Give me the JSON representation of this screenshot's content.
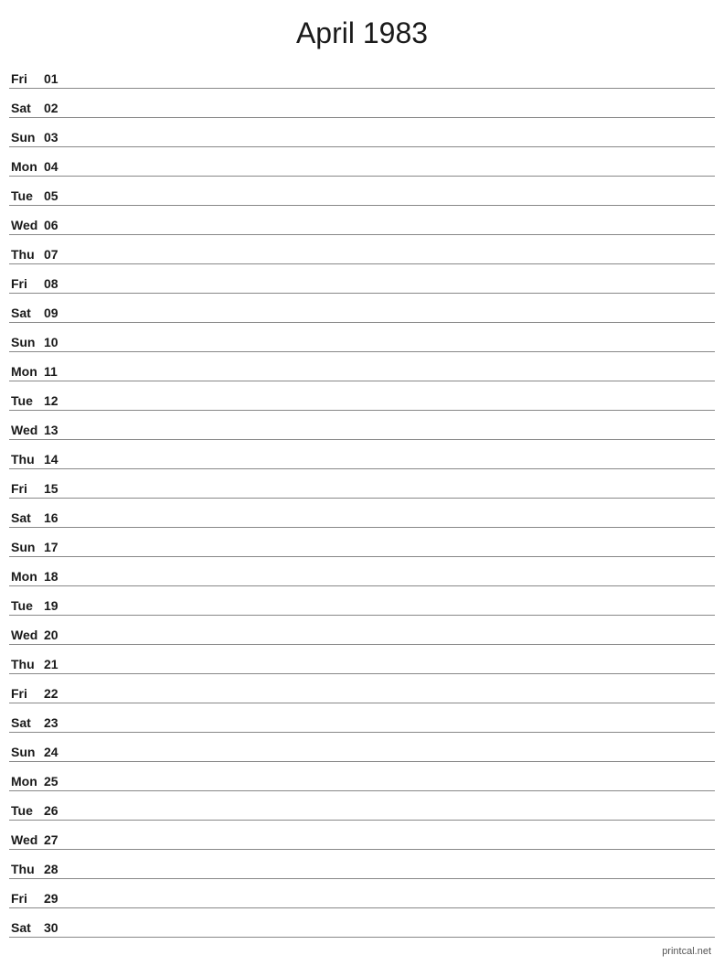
{
  "title": "April 1983",
  "footer": "printcal.net",
  "days": [
    {
      "name": "Fri",
      "number": "01"
    },
    {
      "name": "Sat",
      "number": "02"
    },
    {
      "name": "Sun",
      "number": "03"
    },
    {
      "name": "Mon",
      "number": "04"
    },
    {
      "name": "Tue",
      "number": "05"
    },
    {
      "name": "Wed",
      "number": "06"
    },
    {
      "name": "Thu",
      "number": "07"
    },
    {
      "name": "Fri",
      "number": "08"
    },
    {
      "name": "Sat",
      "number": "09"
    },
    {
      "name": "Sun",
      "number": "10"
    },
    {
      "name": "Mon",
      "number": "11"
    },
    {
      "name": "Tue",
      "number": "12"
    },
    {
      "name": "Wed",
      "number": "13"
    },
    {
      "name": "Thu",
      "number": "14"
    },
    {
      "name": "Fri",
      "number": "15"
    },
    {
      "name": "Sat",
      "number": "16"
    },
    {
      "name": "Sun",
      "number": "17"
    },
    {
      "name": "Mon",
      "number": "18"
    },
    {
      "name": "Tue",
      "number": "19"
    },
    {
      "name": "Wed",
      "number": "20"
    },
    {
      "name": "Thu",
      "number": "21"
    },
    {
      "name": "Fri",
      "number": "22"
    },
    {
      "name": "Sat",
      "number": "23"
    },
    {
      "name": "Sun",
      "number": "24"
    },
    {
      "name": "Mon",
      "number": "25"
    },
    {
      "name": "Tue",
      "number": "26"
    },
    {
      "name": "Wed",
      "number": "27"
    },
    {
      "name": "Thu",
      "number": "28"
    },
    {
      "name": "Fri",
      "number": "29"
    },
    {
      "name": "Sat",
      "number": "30"
    }
  ]
}
